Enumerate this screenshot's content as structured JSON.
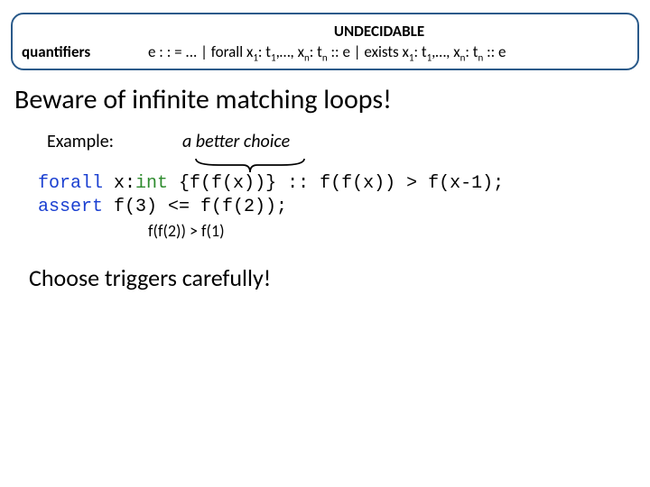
{
  "ruleBox": {
    "undecidable": "UNDECIDABLE",
    "label": "quantifiers",
    "grammar_pre": "e : : = ... | forall x",
    "s1": "1",
    "grammar_mid1": ": t",
    "s2": "1",
    "grammar_mid2": ",…, x",
    "s3": "n",
    "grammar_mid3": ": t",
    "s4": "n",
    "grammar_mid4": " :: e | exists x",
    "s5": "1",
    "grammar_mid5": ": t",
    "s6": "1",
    "grammar_mid6": ",…, x",
    "s7": "n",
    "grammar_mid7": ": t",
    "s8": "n",
    "grammar_end": " :: e"
  },
  "heading": "Beware of infinite matching loops!",
  "exampleLabel": "Example:",
  "betterChoice": "a better choice",
  "code": {
    "forall": "forall",
    "var": " x:",
    "type": "int",
    "trigger": " {f(f(x))} :: f(f(x)) > f(x-1);",
    "assert": "assert",
    "assertExpr": " f(3) <= f(f(2));",
    "derived": "f(f(2)) > f(1)"
  },
  "conclusion": "Choose triggers carefully!"
}
